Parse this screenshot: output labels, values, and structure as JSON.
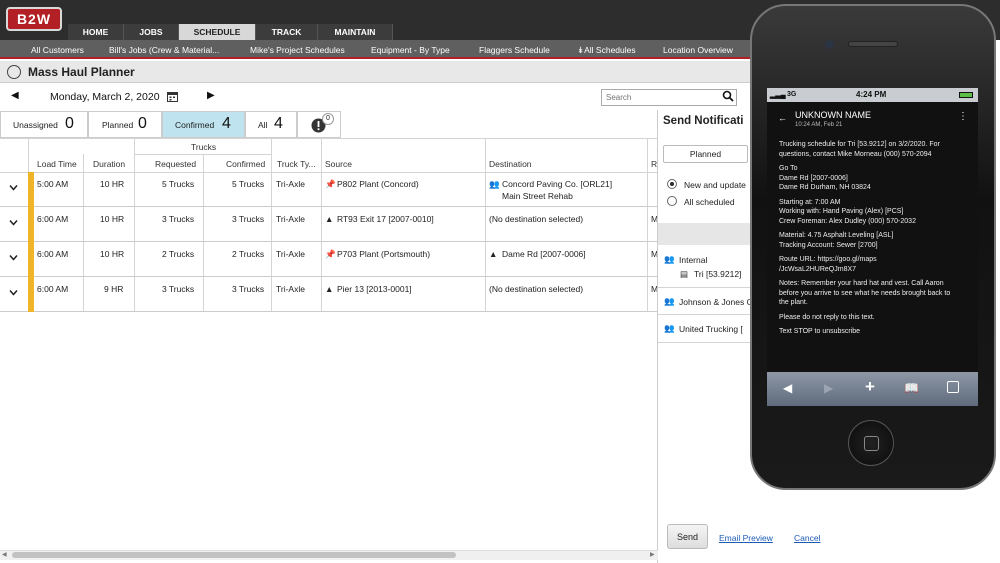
{
  "app": {
    "logo_text": "B2W",
    "brand_color": "#b21f24",
    "accent_color": "#f0b429",
    "selected_tab_color": "#bfe4ef"
  },
  "main_nav": [
    {
      "label": "HOME"
    },
    {
      "label": "JOBS"
    },
    {
      "label": "SCHEDULE"
    },
    {
      "label": "TRACK"
    },
    {
      "label": "MAINTAIN"
    }
  ],
  "sub_nav": [
    {
      "label": "All Customers"
    },
    {
      "label": "Bill's Jobs (Crew & Material..."
    },
    {
      "label": "Mike's Project Schedules"
    },
    {
      "label": "Equipment - By Type"
    },
    {
      "label": "Flaggers Schedule"
    },
    {
      "label": "All Schedules"
    },
    {
      "label": "Location Overview"
    }
  ],
  "page": {
    "title": "Mass Haul Planner",
    "date": "Monday, March 2, 2020"
  },
  "search": {
    "placeholder": "Search"
  },
  "status_tabs": [
    {
      "label": "Unassigned",
      "count": "0"
    },
    {
      "label": "Planned",
      "count": "0"
    },
    {
      "label": "Confirmed",
      "count": "4"
    },
    {
      "label": "All",
      "count": "4"
    },
    {
      "label": "",
      "count": "0"
    }
  ],
  "table": {
    "group_header": "Trucks",
    "headers": [
      "Load Time",
      "Duration",
      "Requested",
      "Confirmed",
      "Truck Ty...",
      "Source",
      "Destination",
      "R"
    ],
    "rows": [
      {
        "load_time": "5:00 AM",
        "duration": "10 HR",
        "requested": "5 Trucks",
        "confirmed": "5 Trucks",
        "truck_type": "Tri-Axle",
        "source": "P802 Plant (Concord)",
        "destination": "Concord Paving Co. [ORL21]",
        "destination2": "Main Street Rehab",
        "extra": ""
      },
      {
        "load_time": "6:00 AM",
        "duration": "10 HR",
        "requested": "3 Trucks",
        "confirmed": "3 Trucks",
        "truck_type": "Tri-Axle",
        "source": "RT93 Exit 17 [2007-0010]",
        "destination": "(No destination selected)",
        "destination2": "",
        "extra": "M"
      },
      {
        "load_time": "6:00 AM",
        "duration": "10 HR",
        "requested": "2 Trucks",
        "confirmed": "2 Trucks",
        "truck_type": "Tri-Axle",
        "source": "P703 Plant (Portsmouth)",
        "destination": "Dame Rd [2007-0006]",
        "destination2": "",
        "extra": "M"
      },
      {
        "load_time": "6:00 AM",
        "duration": "9 HR",
        "requested": "3 Trucks",
        "confirmed": "3 Trucks",
        "truck_type": "Tri-Axle",
        "source": "Pier 13 [2013-0001]",
        "destination": "(No destination selected)",
        "destination2": "",
        "extra": "M"
      }
    ]
  },
  "send_panel": {
    "title": "Send Notificati",
    "filter": "Planned",
    "options": [
      "New and update",
      "All scheduled"
    ],
    "groups": [
      {
        "label": "Internal",
        "sub": "Tri [53.9212]"
      },
      {
        "label": "Johnson & Jones C",
        "sub": ""
      },
      {
        "label": "United Trucking [",
        "sub": ""
      }
    ],
    "send_label": "Send",
    "email_preview_label": "Email Preview",
    "cancel_label": "Cancel"
  },
  "phone": {
    "carrier": "3G",
    "time": "4:24 PM",
    "contact": "UNKNOWN NAME",
    "msg_time": "10:24 AM, Feb 21",
    "lines": [
      "Trucking schedule for Tri [53.9212] on 3/2/2020. For",
      "questions, contact Mike Morneau (000) 570-2094",
      "",
      "Go To",
      "Dame Rd [2007-0006]",
      "Dame Rd Durham, NH 03824",
      "",
      "Starting at: 7:00 AM",
      "Working with: Hand Paving (Alex) [PCS]",
      "Crew Foreman: Alex Dudley (000) 570-2032",
      "",
      "Material: 4.75 Asphalt Leveling [ASL]",
      "Tracking Account: Sewer [2700]",
      "",
      "Route URL: https://goo.gl/maps",
      "/JcWsaL2HUReQJm8X7",
      "",
      "Notes: Remember your hard hat and vest. Call Aaron",
      "before you arrive to see what he needs brought back to",
      "the plant.",
      "",
      "Please do not reply to this text.",
      "",
      "Text STOP to unsubscribe"
    ]
  }
}
